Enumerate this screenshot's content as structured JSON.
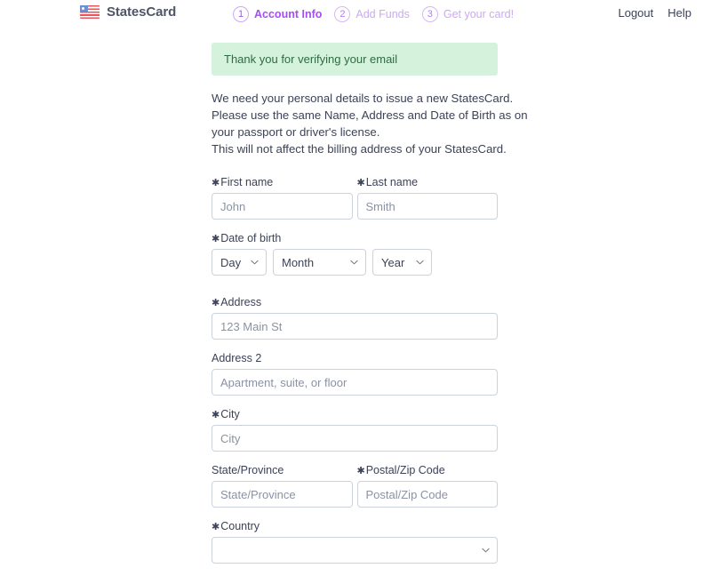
{
  "brand": {
    "name": "StatesCard",
    "icon": "us-flag-icon"
  },
  "steps": [
    {
      "num": "1",
      "label": "Account Info",
      "active": true
    },
    {
      "num": "2",
      "label": "Add Funds",
      "active": false
    },
    {
      "num": "3",
      "label": "Get your card!",
      "active": false
    }
  ],
  "nav": {
    "logout": "Logout",
    "help": "Help"
  },
  "banner": {
    "text": "Thank you for verifying your email",
    "bg": "#d5f2dd",
    "fg": "#2f6b41"
  },
  "intro": {
    "line1": "We need your personal details to issue a new StatesCard.",
    "line2": "Please use the same Name, Address and Date of Birth as on",
    "line3": "your passport or driver's license.",
    "line4": "This will not affect the billing address of your StatesCard."
  },
  "required_mark": "✱",
  "form": {
    "first_name": {
      "label": "First name",
      "placeholder": "John",
      "value": "",
      "required": true
    },
    "last_name": {
      "label": "Last name",
      "placeholder": "Smith",
      "value": "",
      "required": true
    },
    "dob": {
      "label": "Date of birth",
      "required": true,
      "day": {
        "selected": "Day",
        "options": [
          "Day"
        ]
      },
      "month": {
        "selected": "Month",
        "options": [
          "Month"
        ]
      },
      "year": {
        "selected": "Year",
        "options": [
          "Year"
        ]
      }
    },
    "address": {
      "label": "Address",
      "placeholder": "123 Main St",
      "value": "",
      "required": true
    },
    "address2": {
      "label": "Address 2",
      "placeholder": "Apartment, suite, or floor",
      "value": "",
      "required": false
    },
    "city": {
      "label": "City",
      "placeholder": "City",
      "value": "",
      "required": true
    },
    "state": {
      "label": "State/Province",
      "placeholder": "State/Province",
      "value": "",
      "required": false
    },
    "postal": {
      "label": "Postal/Zip Code",
      "placeholder": "Postal/Zip Code",
      "value": "",
      "required": true
    },
    "country": {
      "label": "Country",
      "selected": "",
      "options": [
        ""
      ],
      "required": true
    }
  },
  "theme": {
    "accent": "#a64df5",
    "accent_muted": "#cbaaf2",
    "border": "#ccd2db",
    "text": "#3c4257",
    "placeholder": "#8a92a3"
  }
}
